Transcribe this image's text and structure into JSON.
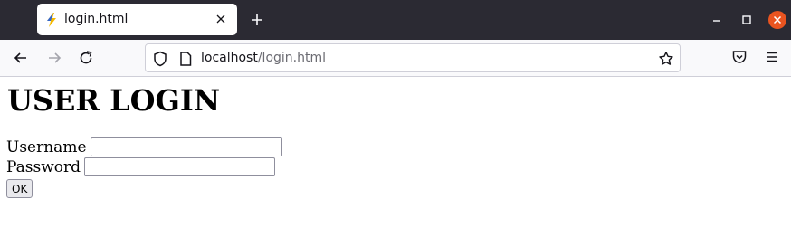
{
  "browser": {
    "tab": {
      "title": "login.html",
      "favicon": "lightning-bolt-icon"
    },
    "address": {
      "host": "localhost",
      "path": "/login.html"
    },
    "colors": {
      "titlebar": "#2b2a33",
      "close_button": "#e95420"
    }
  },
  "page": {
    "heading": "USER LOGIN",
    "username_label": "Username",
    "password_label": "Password",
    "username_value": "",
    "password_value": "",
    "submit_label": "OK"
  }
}
